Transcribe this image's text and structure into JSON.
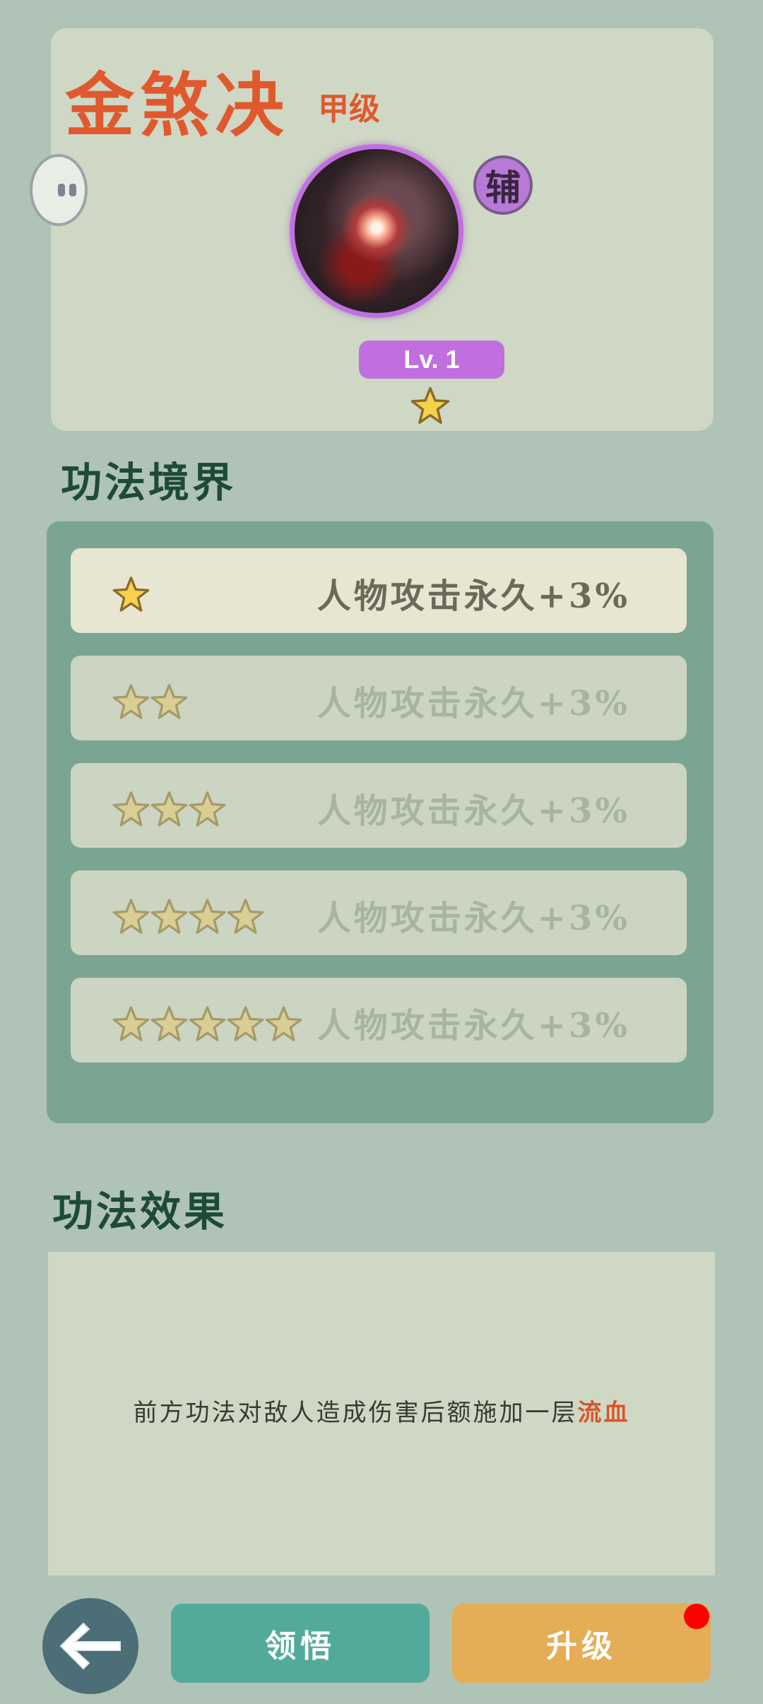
{
  "skill": {
    "name": "金煞决",
    "grade": "甲级",
    "role_badge": "辅",
    "level_label": "Lv. 1",
    "stars": 1,
    "icon": "skill-blood-burst-icon"
  },
  "realm": {
    "title": "功法境界",
    "rows": [
      {
        "stars": 1,
        "text": "人物攻击永久+3%",
        "active": true
      },
      {
        "stars": 2,
        "text": "人物攻击永久+3%",
        "active": false
      },
      {
        "stars": 3,
        "text": "人物攻击永久+3%",
        "active": false
      },
      {
        "stars": 4,
        "text": "人物攻击永久+3%",
        "active": false
      },
      {
        "stars": 5,
        "text": "人物攻击永久+3%",
        "active": false
      }
    ]
  },
  "effect": {
    "title": "功法效果",
    "text_prefix": "前方功法对敌人造成伤害后额施加一层",
    "keyword": "流血"
  },
  "buttons": {
    "learn_label": "领悟",
    "upgrade_label": "升级",
    "upgrade_has_notification": true
  },
  "colors": {
    "accent_orange": "#e0592e",
    "level_purple": "#c06ee0",
    "learn_green": "#52ab9a",
    "upgrade_orange": "#e4ad56",
    "notification_red": "#ff0000"
  }
}
